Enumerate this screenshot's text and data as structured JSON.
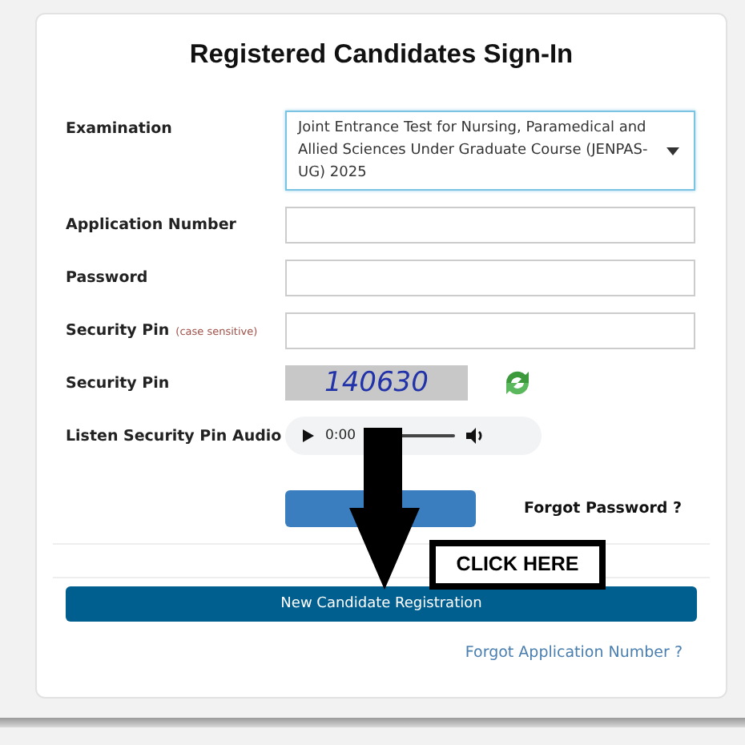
{
  "title": "Registered Candidates Sign-In",
  "fields": [
    {
      "kind": "select",
      "label": "Examination",
      "value": "Joint Entrance Test for Nursing, Paramedical and Allied Sciences Under Graduate Course (JENPAS-UG) 2025"
    },
    {
      "kind": "text",
      "label": "Application Number"
    },
    {
      "kind": "text",
      "label": "Password"
    },
    {
      "kind": "text",
      "label": "Security Pin",
      "note": "(case sensitive)"
    },
    {
      "kind": "captcha",
      "label": "Security Pin",
      "code": "140630"
    },
    {
      "kind": "audio",
      "label": "Listen Security Pin Audio",
      "time": "0:00"
    }
  ],
  "forgot_password": "Forgot Password ?",
  "annotation": "CLICK HERE",
  "register_button": "New Candidate Registration",
  "forgot_application_number": "Forgot Application Number ?"
}
